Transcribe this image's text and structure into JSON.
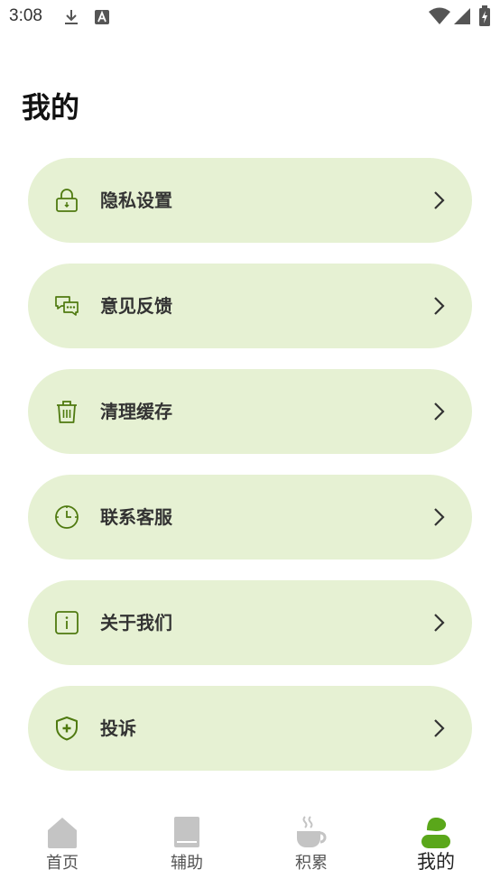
{
  "status_bar": {
    "time": "3:08",
    "icons": [
      "download-icon",
      "font-icon",
      "wifi-icon",
      "signal-icon",
      "battery-icon"
    ]
  },
  "page": {
    "title": "我的"
  },
  "menu": {
    "items": [
      {
        "label": "隐私设置",
        "icon": "lock-icon"
      },
      {
        "label": "意见反馈",
        "icon": "chat-bubbles-icon"
      },
      {
        "label": "清理缓存",
        "icon": "trash-icon"
      },
      {
        "label": "联系客服",
        "icon": "clock-icon"
      },
      {
        "label": "关于我们",
        "icon": "info-icon"
      },
      {
        "label": "投诉",
        "icon": "shield-plus-icon"
      }
    ]
  },
  "tabs": [
    {
      "label": "首页",
      "icon": "home-icon"
    },
    {
      "label": "辅助",
      "icon": "book-icon"
    },
    {
      "label": "积累",
      "icon": "coffee-cup-icon"
    },
    {
      "label": "我的",
      "icon": "user-icon",
      "active": true
    }
  ],
  "colors": {
    "card_bg": "#e6f1d3",
    "accent": "#4f7a10",
    "active_tab": "#5aa71a",
    "inactive_tab": "#c4c4c4"
  }
}
